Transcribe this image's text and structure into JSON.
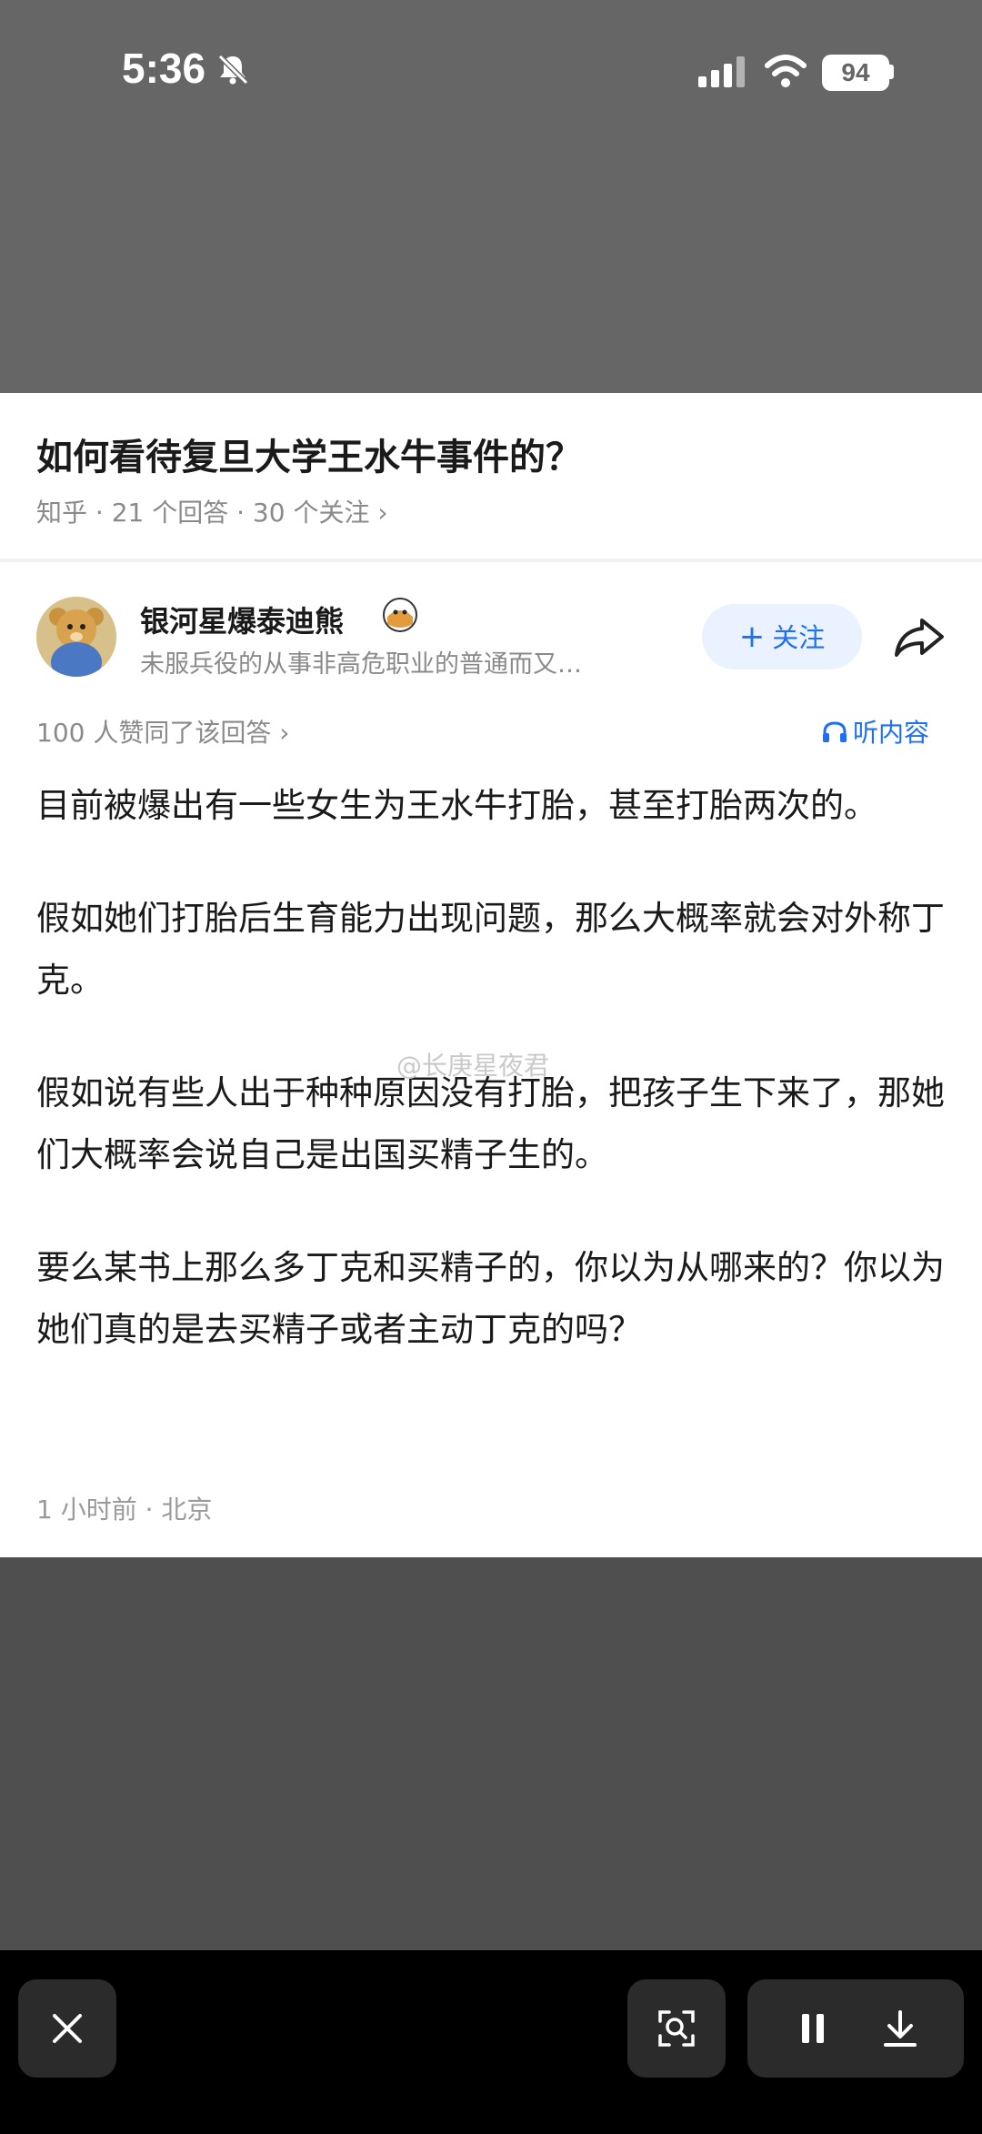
{
  "status_bar": {
    "time": "5:36",
    "battery": "94",
    "icons": [
      "bell-mute-icon",
      "signal-icon",
      "wifi-icon",
      "battery-icon"
    ]
  },
  "question": {
    "title": "如何看待复旦大学王水牛事件的？",
    "meta": "知乎 · 21 个回答 · 30 个关注 ›"
  },
  "author": {
    "name": "银河星爆泰迪熊",
    "bio": "未服兵役的从事非高危职业的普通而又…",
    "follow_label": "关注",
    "follow_plus": "+"
  },
  "answer_meta": {
    "upvotes": "100 人赞同了该回答 ›",
    "listen_label": "听内容"
  },
  "answer": {
    "paragraphs": [
      "目前被爆出有一些女生为王水牛打胎，甚至打胎两次的。",
      "假如她们打胎后生育能力出现问题，那么大概率就会对外称丁克。",
      "假如说有些人出于种种原因没有打胎，把孩子生下来了，那她们大概率会说自己是出国买精子生的。",
      "要么某书上那么多丁克和买精子的，你以为从哪来的？你以为她们真的是去买精子或者主动丁克的吗？"
    ],
    "time_location": "1 小时前 · 北京"
  },
  "watermark": "@长庚星夜君",
  "colors": {
    "accent": "#1f6ff2",
    "follow_bg": "#eaf2ff",
    "muted_text": "#8a8a8a",
    "toolbar_bg": "#000000",
    "toolbar_button_bg": "#2b2b2b"
  }
}
